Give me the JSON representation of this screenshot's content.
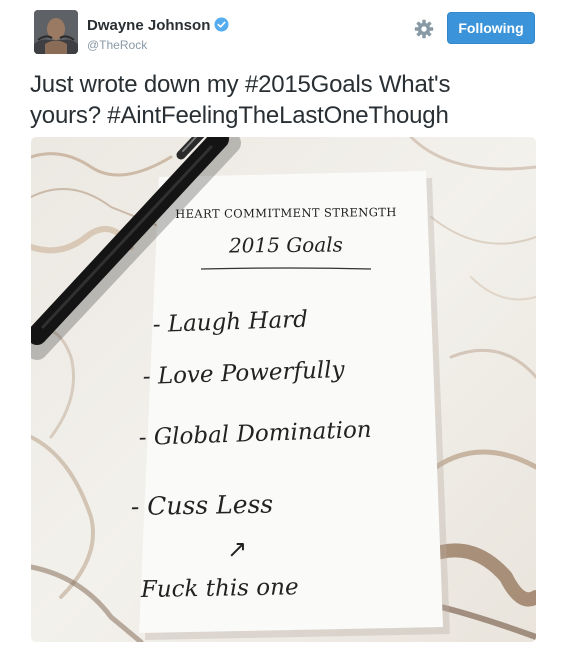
{
  "user": {
    "name": "Dwayne Johnson",
    "handle": "@TheRock",
    "verified": true
  },
  "follow_button": {
    "label": "Following",
    "color": "#3b94d9"
  },
  "tweet": {
    "line1": "Just wrote down my #2015Goals What's",
    "line2": "yours? #AintFeelingTheLastOneThough"
  },
  "photo": {
    "note_header": "HEART COMMITMENT STRENGTH",
    "note_title": "2015 Goals",
    "goals": [
      "- Laugh Hard",
      "- Love Powerfully",
      "- Global Domination",
      "- Cuss Less"
    ],
    "arrow": "↗",
    "footnote": "Fuck this one"
  },
  "icons": {
    "settings": "gear-icon",
    "verified": "verified-badge-icon"
  }
}
